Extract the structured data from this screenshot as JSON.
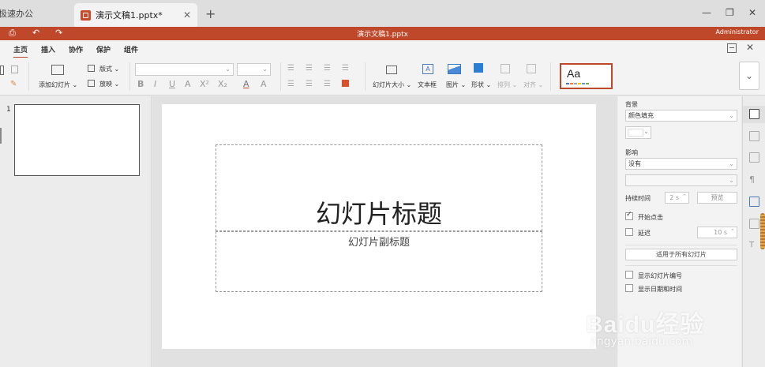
{
  "tabbar": {
    "home_tab": "极速办公",
    "active_tab": "演示文稿1.pptx*",
    "close_glyph": "✕",
    "add_glyph": "+",
    "minimize_glyph": "—",
    "restore_glyph": "❐",
    "window_close_glyph": "✕"
  },
  "titlebar": {
    "title": "演示文稿1.pptx",
    "user": "Administrator",
    "accent_color": "#c0482a"
  },
  "menu": {
    "items": [
      "主页",
      "插入",
      "协作",
      "保护",
      "组件"
    ],
    "active_index": 0
  },
  "ribbon": {
    "add_slide": "添加幻灯片",
    "layout": "版式",
    "play": "放映",
    "format_buttons": [
      "B",
      "I",
      "U",
      "A",
      "X²",
      "X₂"
    ],
    "slide_size": "幻灯片大小",
    "text_box": "文本框",
    "picture": "图片",
    "shape": "形状",
    "arrange": "排列",
    "align": "对齐",
    "theme_sample": "Aa",
    "theme_colors": [
      "#4472c4",
      "#ed7d31",
      "#a5a5a5",
      "#ffc000",
      "#5b9bd5",
      "#70ad47"
    ]
  },
  "slides_panel": {
    "slide_number": "1"
  },
  "slide": {
    "title": "幻灯片标题",
    "subtitle": "幻灯片副标题"
  },
  "properties": {
    "background_label": "背景",
    "fill_value": "颜色填充",
    "effect_label": "影响",
    "effect_value": "没有",
    "duration_label": "持续时间",
    "duration_value": "2 s",
    "preview_button": "预览",
    "start_on_click_label": "开始点击",
    "start_on_click_checked": true,
    "delay_label": "延迟",
    "delay_checked": false,
    "delay_value": "10 s",
    "apply_all_button": "适用于所有幻灯片",
    "show_slide_number_label": "显示幻灯片编号",
    "show_date_label": "显示日期和时间"
  },
  "watermark": {
    "brand": "Baidu经验",
    "url": "jingyan.baidu.com"
  }
}
